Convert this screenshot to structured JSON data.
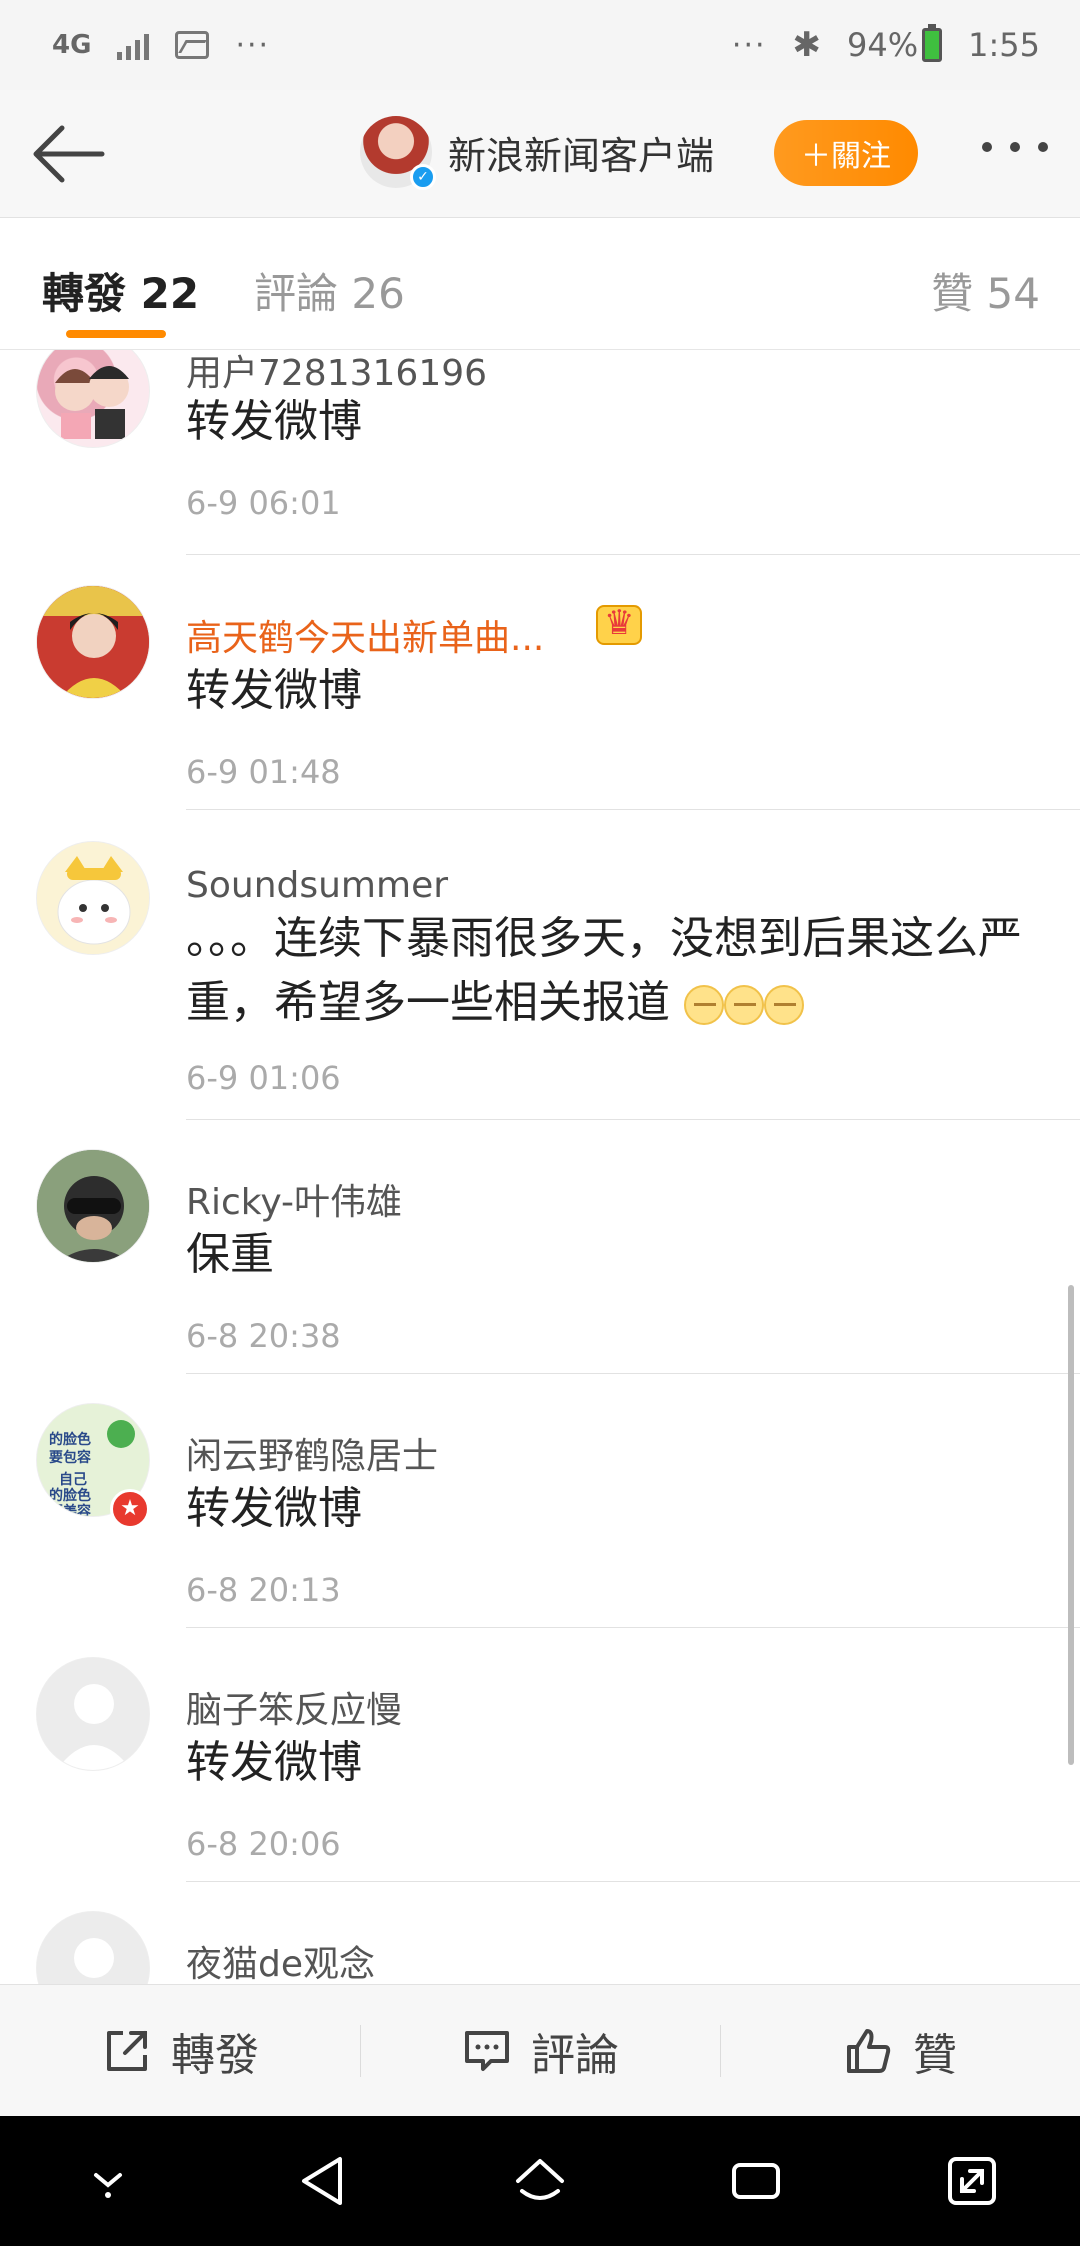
{
  "status_bar": {
    "network": "4G",
    "dots_left": "···",
    "dots_right": "···",
    "battery": "94%",
    "time": "1:55"
  },
  "header": {
    "title": "新浪新闻客户端",
    "follow_label": "＋關注"
  },
  "tabs": {
    "repost": "轉發 22",
    "comment": "評論 26",
    "like": "贊 54"
  },
  "feed": [
    {
      "user": "用户7281316196",
      "content": "转发微博",
      "time": "6-9 06:01"
    },
    {
      "user": "高天鹤今天出新单曲...",
      "content": "转发微博",
      "time": "6-9 01:48"
    },
    {
      "user": "Soundsummer",
      "content": "。。。连续下暴雨很多天，没想到后果这么严重，希望多一些相关报道",
      "time": "6-9 01:06"
    },
    {
      "user": "Ricky-叶伟雄",
      "content": "保重",
      "time": "6-8 20:38"
    },
    {
      "user": "闲云野鹤隐居士",
      "content": "转发微博",
      "time": "6-8 20:13",
      "avatar_text": "别人的脸色要包容 自己的脸色要美容"
    },
    {
      "user": "脑子笨反应慢",
      "content": "转发微博",
      "time": "6-8 20:06"
    },
    {
      "user": "夜猫de观念",
      "content": "",
      "time": ""
    }
  ],
  "actions": {
    "repost": "轉發",
    "comment": "評論",
    "like": "贊"
  },
  "colors": {
    "accent": "#ff8a00",
    "vip_name": "#e9631a"
  }
}
